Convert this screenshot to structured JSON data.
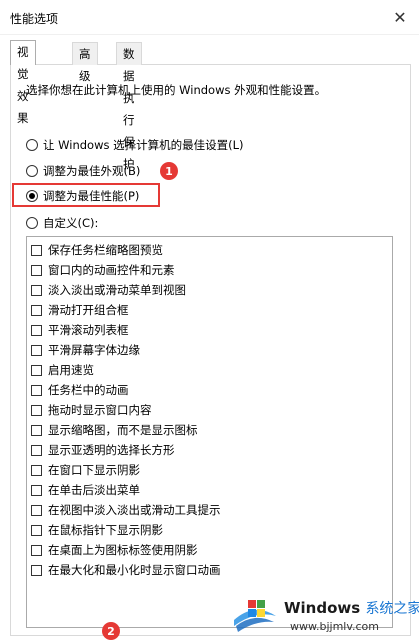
{
  "window": {
    "title": "性能选项",
    "close_glyph": "✕"
  },
  "tabs": [
    {
      "label": "视觉效果",
      "active": true
    },
    {
      "label": "高级",
      "active": false
    },
    {
      "label": "数据执行保护",
      "active": false
    }
  ],
  "description": "选择你想在此计算机上使用的 Windows 外观和性能设置。",
  "radios": [
    {
      "label": "让 Windows 选择计算机的最佳设置(L)",
      "checked": false
    },
    {
      "label": "调整为最佳外观(B)",
      "checked": false
    },
    {
      "label": "调整为最佳性能(P)",
      "checked": true
    },
    {
      "label": "自定义(C):",
      "checked": false
    }
  ],
  "options": [
    "保存任务栏缩略图预览",
    "窗口内的动画控件和元素",
    "淡入淡出或滑动菜单到视图",
    "滑动打开组合框",
    "平滑滚动列表框",
    "平滑屏幕字体边缘",
    "启用速览",
    "任务栏中的动画",
    "拖动时显示窗口内容",
    "显示缩略图，而不是显示图标",
    "显示亚透明的选择长方形",
    "在窗口下显示阴影",
    "在单击后淡出菜单",
    "在视图中淡入淡出或滑动工具提示",
    "在鼠标指针下显示阴影",
    "在桌面上为图标标签使用阴影",
    "在最大化和最小化时显示窗口动画"
  ],
  "annotations": {
    "badge1": "1",
    "badge2": "2",
    "color": "#e53935"
  },
  "watermark": {
    "brand": "Windows",
    "brand_cn": "系统之家",
    "url": "www.bjjmlv.com"
  }
}
